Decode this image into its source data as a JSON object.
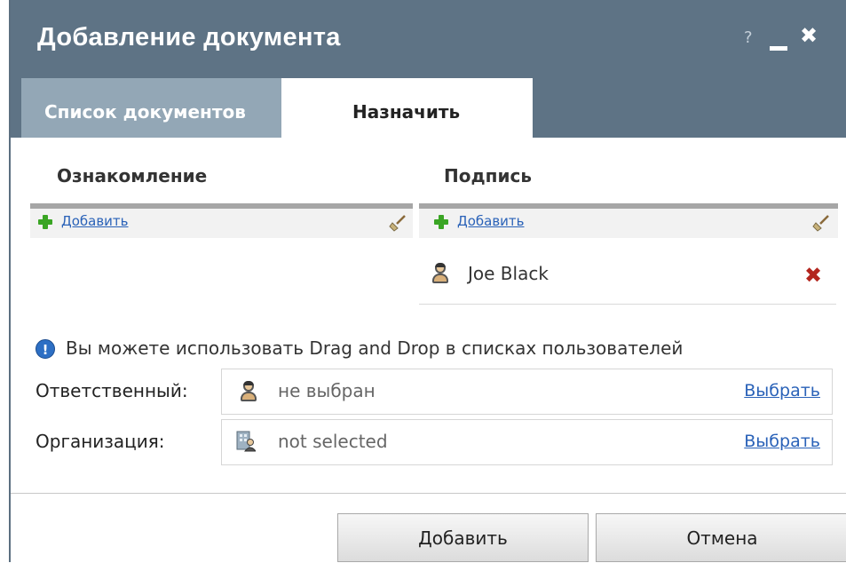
{
  "dialog": {
    "title": "Добавление документа",
    "help_label": "?",
    "tabs": [
      {
        "label": "Список документов",
        "active": false
      },
      {
        "label": "Назначить",
        "active": true
      }
    ]
  },
  "sections": {
    "review": {
      "title": "Ознакомление",
      "add_label": "Добавить",
      "items": []
    },
    "signature": {
      "title": "Подпись",
      "add_label": "Добавить",
      "items": [
        {
          "name": "Joe Black"
        }
      ]
    }
  },
  "info": {
    "text": "Вы можете использовать Drag and Drop в списках пользователей"
  },
  "fields": {
    "responsible": {
      "label": "Ответственный:",
      "value": "не выбран",
      "action": "Выбрать"
    },
    "organization": {
      "label": "Организация:",
      "value": "not selected",
      "action": "Выбрать"
    }
  },
  "buttons": {
    "add": "Добавить",
    "cancel": "Отмена"
  },
  "colors": {
    "titlebar": "#5e7385",
    "inactive_tab": "#93a7b6",
    "link": "#2a62b8",
    "delete": "#b3261e",
    "add_icon": "#3aa524"
  },
  "icons": [
    "plus-icon",
    "broom-icon",
    "person-icon",
    "delete-icon",
    "info-icon",
    "organization-icon",
    "close-icon",
    "minimize-icon",
    "help-icon"
  ]
}
